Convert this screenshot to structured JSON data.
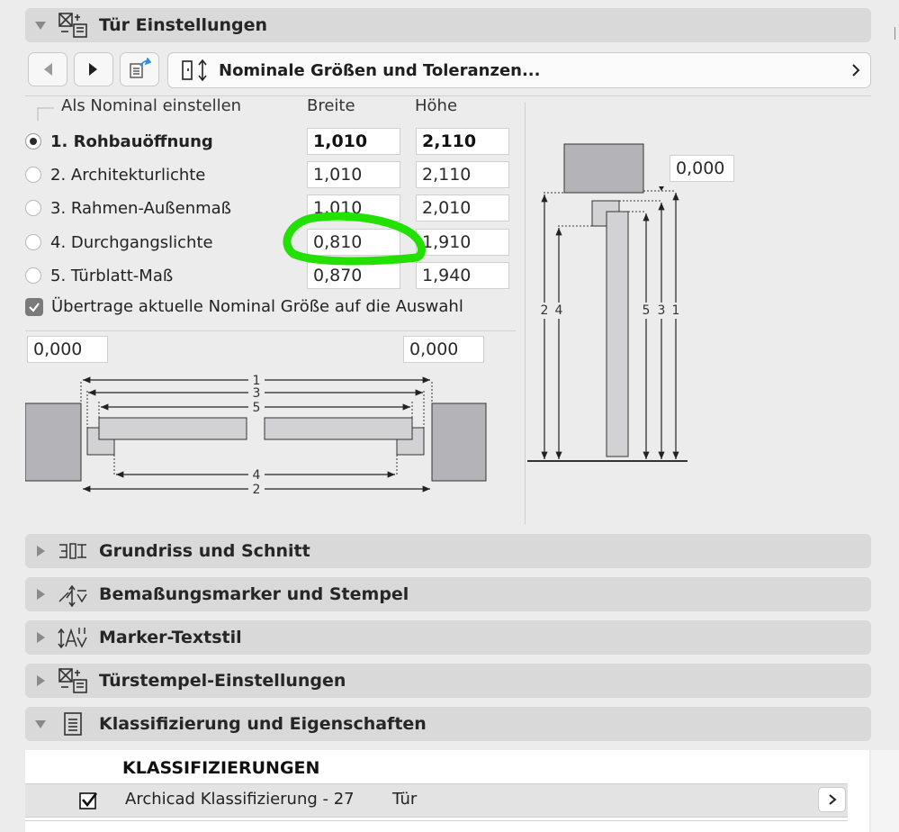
{
  "panels": {
    "door_settings": {
      "title": "Tür Einstellungen",
      "expanded": true
    },
    "floorplan": {
      "title": "Grundriss und Schnitt"
    },
    "dimension_markers": {
      "title": "Bemaßungsmarker und Stempel"
    },
    "marker_textstyle": {
      "title": "Marker-Textstil"
    },
    "door_stamp": {
      "title": "Türstempel-Einstellungen"
    },
    "classification": {
      "title": "Klassifizierung und Eigenschaften",
      "expanded": true
    }
  },
  "page_selector": {
    "title": "Nominale Größen und Toleranzen..."
  },
  "nominal": {
    "group_label": "Als Nominal einstellen",
    "col_width": "Breite",
    "col_height": "Höhe",
    "options": [
      {
        "label": "1. Rohbauöffnung",
        "width": "1,010",
        "height": "2,110",
        "selected": true
      },
      {
        "label": "2. Architekturlichte",
        "width": "1,010",
        "height": "2,110"
      },
      {
        "label": "3. Rahmen-Außenmaß",
        "width": "1,010",
        "height": "2,010"
      },
      {
        "label": "4. Durchgangslichte",
        "width": "0,810",
        "height": "1,910"
      },
      {
        "label": "5. Türblatt-Maß",
        "width": "0,870",
        "height": "1,940"
      }
    ],
    "transfer_label": "Übertrage aktuelle Nominal Größe auf die Auswahl",
    "transfer_checked": true
  },
  "tolerances": {
    "left": "0,000",
    "right": "0,000",
    "top": "0,000"
  },
  "plan_dims": [
    "1",
    "3",
    "5",
    "4",
    "2"
  ],
  "section_dims": [
    "2",
    "4",
    "5",
    "3",
    "1"
  ],
  "classification": {
    "heading": "KLASSIFIZIERUNGEN",
    "row": {
      "system": "Archicad Klassifizierung - 27",
      "value": "Tür",
      "checked": true
    }
  },
  "colors": {
    "highlight": "#22e000",
    "header_bg": "#d9d9d9",
    "box_fill": "#b4b4b8"
  }
}
